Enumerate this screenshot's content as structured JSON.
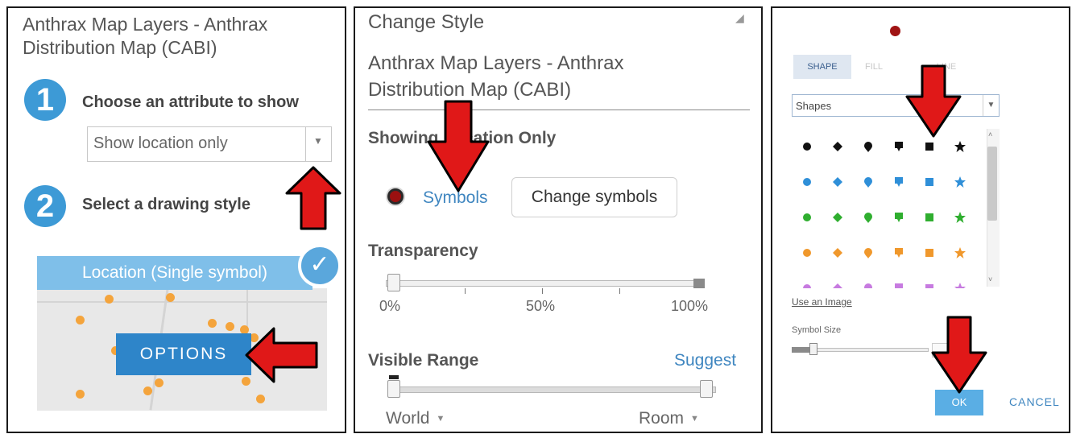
{
  "panel1": {
    "title": "Anthrax Map Layers - Anthrax Distribution Map (CABI)",
    "step1": {
      "number": "1",
      "label": "Choose an attribute to show"
    },
    "attribute_select": {
      "value": "Show location only"
    },
    "step2": {
      "number": "2",
      "label": "Select a drawing style"
    },
    "style_card": {
      "label": "Location (Single symbol)",
      "selected": true
    },
    "options_label": "OPTIONS"
  },
  "panel2": {
    "header": "Change Style",
    "layer_title": "Anthrax Map Layers - Anthrax Distribution Map (CABI)",
    "showing_label": "Showing Location Only",
    "symbols_link": "Symbols",
    "change_symbols_label": "Change symbols",
    "transparency": {
      "label": "Transparency",
      "value_percent": 0,
      "ticks": [
        "0%",
        "50%",
        "100%"
      ]
    },
    "visible_range": {
      "label": "Visible Range",
      "suggest_label": "Suggest",
      "min_label": "World",
      "max_label": "Room"
    }
  },
  "panel3": {
    "current_symbol_color": "#a01414",
    "tabs": [
      {
        "label": "SHAPE",
        "active": true
      },
      {
        "label": "FILL",
        "active": false
      },
      {
        "label": "LINE",
        "active": false
      }
    ],
    "shape_category": "Shapes",
    "symbol_shapes": [
      "circle",
      "diamond",
      "pin",
      "callout",
      "square",
      "star"
    ],
    "symbol_colors": [
      "#111111",
      "#2f8fd8",
      "#2fae2f",
      "#f0982c",
      "#c77be0"
    ],
    "use_image_label": "Use an Image",
    "symbol_size_label": "Symbol Size",
    "ok_label": "OK",
    "cancel_label": "CANCEL"
  },
  "colors": {
    "accent_blue": "#3d9ad6",
    "options_blue": "#2e85c9",
    "link_blue": "#3f86c0",
    "marker_orange": "#f4a43c",
    "annotation_red": "#e01818"
  }
}
